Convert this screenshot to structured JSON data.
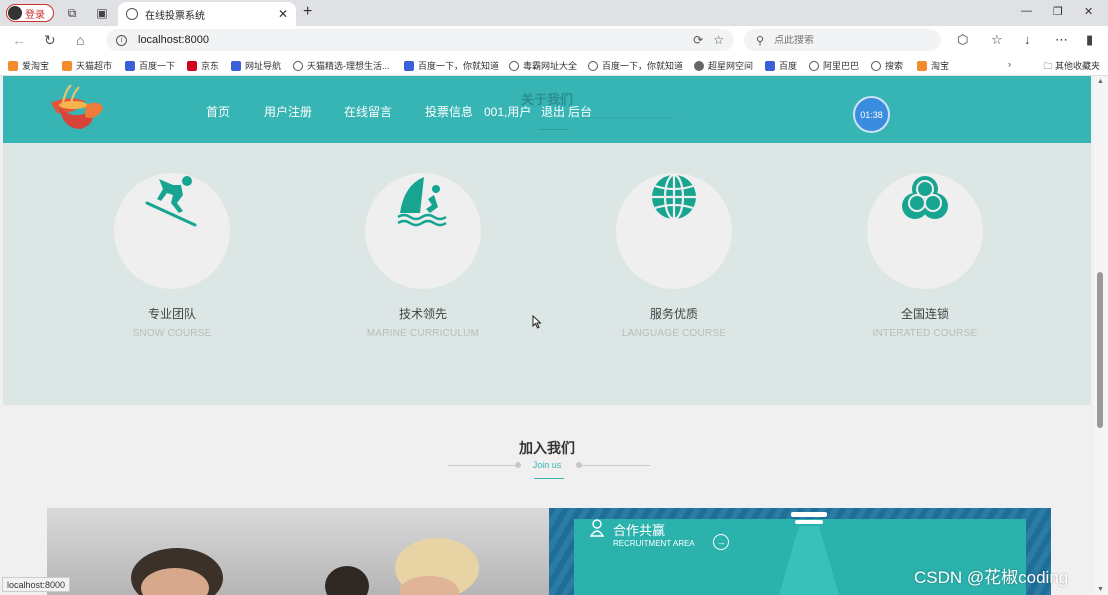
{
  "browser": {
    "profile_label": "登录",
    "tab_title": "在线投票系统",
    "url": "localhost:8000",
    "search_placeholder": "点此搜索",
    "status_url": "localhost:8000",
    "bookmarks": [
      "爱淘宝",
      "天猫超市",
      "百度一下",
      "京东",
      "网址导航",
      "天猫精选-理想生活...",
      "百度一下，你就知道",
      "毒霸网址大全",
      "百度一下，你就知道",
      "超星网空间",
      "百度",
      "阿里巴巴",
      "搜索",
      "淘宝"
    ],
    "other_bookmarks": "其他收藏夹"
  },
  "site": {
    "nav": [
      "首页",
      "用户注册",
      "在线留言",
      "投票信息"
    ],
    "user_info": "001,用户",
    "logout": "退出",
    "admin": "后台",
    "section_ghost_title": "关于我们",
    "timer": "01:38",
    "accent_color": "#37b5b5"
  },
  "features": [
    {
      "title": "专业团队",
      "subtitle": "SNOW COURSE",
      "icon": "skier-icon"
    },
    {
      "title": "技术领先",
      "subtitle": "MARINE CURRICULUM",
      "icon": "windsurf-icon"
    },
    {
      "title": "服务优质",
      "subtitle": "LANGUAGE COURSE",
      "icon": "globe-icon"
    },
    {
      "title": "全国连锁",
      "subtitle": "INTERATED COURSE",
      "icon": "trefoil-icon"
    }
  ],
  "join": {
    "title": "加入我们",
    "subtitle": "Join us",
    "recruit_title": "合作共赢",
    "recruit_subtitle": "RECRUITMENT AREA"
  },
  "watermark": "CSDN @花椒coding"
}
